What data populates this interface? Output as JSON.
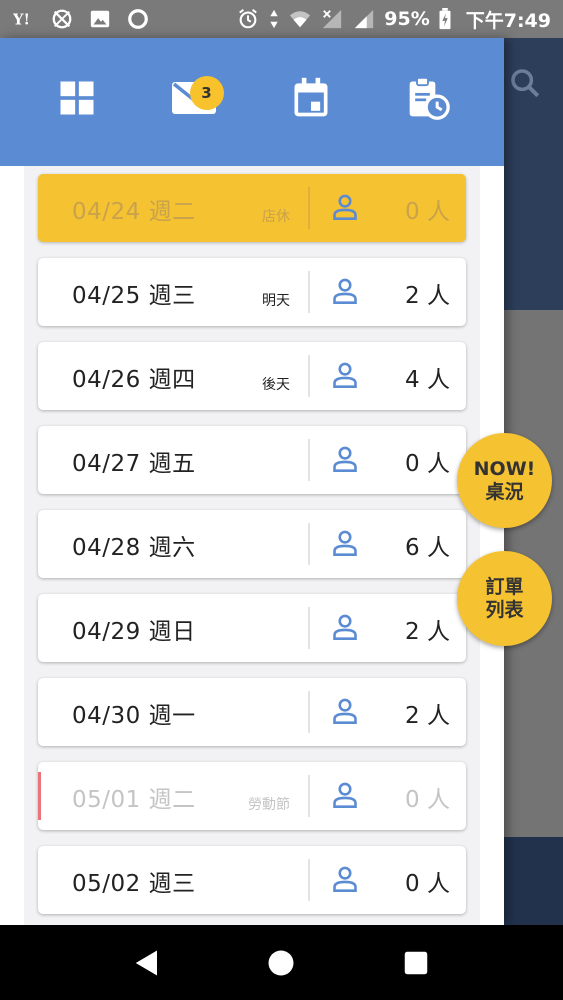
{
  "status_bar": {
    "battery": "95%",
    "time": "下午7:49"
  },
  "header": {
    "mail_badge": "3"
  },
  "dates": [
    {
      "date": "04/24 週二",
      "note": "店休",
      "count": "0 人",
      "state": "closed"
    },
    {
      "date": "04/25 週三",
      "note": "明天",
      "count": "2 人",
      "state": "normal"
    },
    {
      "date": "04/26 週四",
      "note": "後天",
      "count": "4 人",
      "state": "normal"
    },
    {
      "date": "04/27 週五",
      "note": "",
      "count": "0 人",
      "state": "normal"
    },
    {
      "date": "04/28 週六",
      "note": "",
      "count": "6 人",
      "state": "normal"
    },
    {
      "date": "04/29 週日",
      "note": "",
      "count": "2 人",
      "state": "normal"
    },
    {
      "date": "04/30 週一",
      "note": "",
      "count": "2 人",
      "state": "normal"
    },
    {
      "date": "05/01 週二",
      "note": "勞動節",
      "count": "0 人",
      "state": "holiday"
    },
    {
      "date": "05/02 週三",
      "note": "",
      "count": "0 人",
      "state": "normal"
    }
  ],
  "fab": {
    "now_line1": "NOW!",
    "now_line2": "桌況",
    "orders_line1": "訂單",
    "orders_line2": "列表"
  },
  "colors": {
    "header_blue": "#5b8bd2",
    "accent_yellow": "#f5c232",
    "icon_blue": "#5b8bd2",
    "holiday_red": "#e9747a"
  }
}
